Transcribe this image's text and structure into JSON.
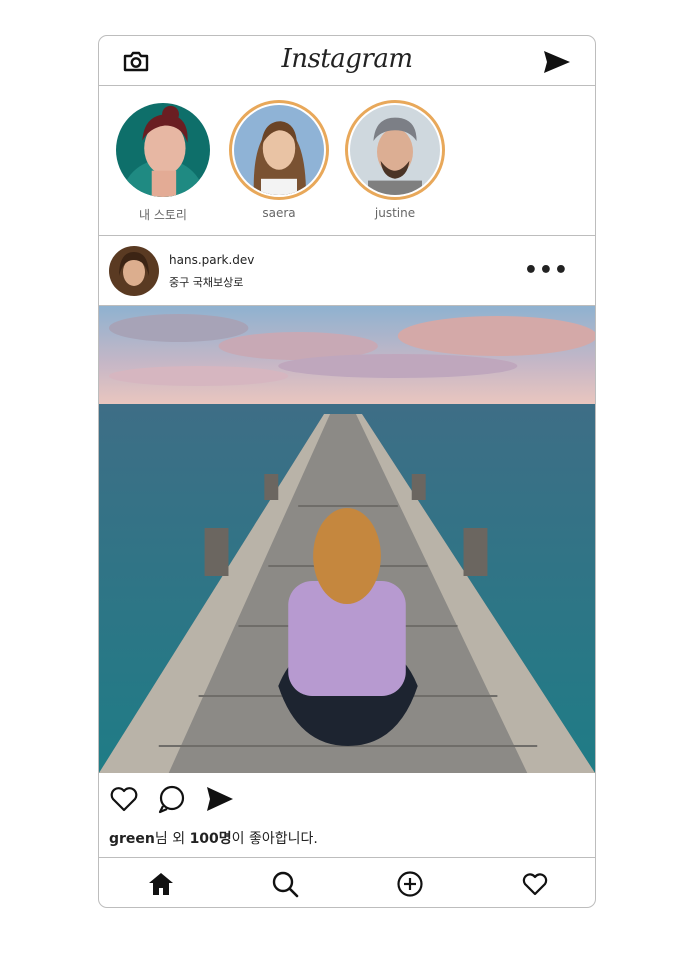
{
  "header": {
    "logo": "Instagram",
    "camera_icon": "camera-icon",
    "send_icon": "paper-plane-icon"
  },
  "stories": [
    {
      "label": "내 스토리",
      "active": false
    },
    {
      "label": "saera",
      "active": true
    },
    {
      "label": "justine",
      "active": true
    }
  ],
  "post": {
    "username": "hans.park.dev",
    "location": "중구 국채보상로",
    "more_label": "•••",
    "likes": {
      "user": "green",
      "mid": "님 외 ",
      "count": "100명",
      "tail": "이 좋아합니다."
    }
  },
  "colors": {
    "story_ring": "#e8a85a",
    "border": "#bdbdbd",
    "text": "#222222"
  },
  "actions": [
    "heart-icon",
    "comment-icon",
    "share-icon"
  ],
  "nav": [
    "home-icon",
    "search-icon",
    "add-icon",
    "heart-icon"
  ]
}
